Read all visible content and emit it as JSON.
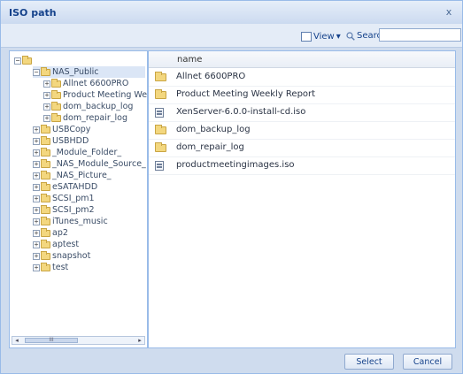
{
  "dialog": {
    "title": "ISO path",
    "close_glyph": "x"
  },
  "toolbar": {
    "view_label": "View",
    "view_arrow": "▾",
    "search_label": "Search",
    "search_value": ""
  },
  "tree": {
    "root": "",
    "items": [
      {
        "label": "NAS_Public",
        "exp": "⊟",
        "depth": 1,
        "selected": true
      },
      {
        "label": "Allnet 6600PRO",
        "exp": "⊞",
        "depth": 2
      },
      {
        "label": "Product Meeting We",
        "exp": "⊞",
        "depth": 2
      },
      {
        "label": "dom_backup_log",
        "exp": "⊞",
        "depth": 2
      },
      {
        "label": "dom_repair_log",
        "exp": "⊞",
        "depth": 2
      },
      {
        "label": "USBCopy",
        "exp": "⊞",
        "depth": 1
      },
      {
        "label": "USBHDD",
        "exp": "⊞",
        "depth": 1
      },
      {
        "label": "_Module_Folder_",
        "exp": "⊞",
        "depth": 1
      },
      {
        "label": "_NAS_Module_Source_",
        "exp": "⊞",
        "depth": 1
      },
      {
        "label": "_NAS_Picture_",
        "exp": "⊞",
        "depth": 1
      },
      {
        "label": "eSATAHDD",
        "exp": "⊞",
        "depth": 1
      },
      {
        "label": "SCSI_pm1",
        "exp": "⊞",
        "depth": 1
      },
      {
        "label": "SCSI_pm2",
        "exp": "⊞",
        "depth": 1
      },
      {
        "label": "iTunes_music",
        "exp": "⊞",
        "depth": 1
      },
      {
        "label": "ap2",
        "exp": "⊞",
        "depth": 1
      },
      {
        "label": "aptest",
        "exp": "⊞",
        "depth": 1
      },
      {
        "label": "snapshot",
        "exp": "⊞",
        "depth": 1
      },
      {
        "label": "test",
        "exp": "⊞",
        "depth": 1
      }
    ]
  },
  "list": {
    "header": "name",
    "rows": [
      {
        "name": "Allnet 6600PRO",
        "type": "folder"
      },
      {
        "name": "Product Meeting Weekly Report",
        "type": "folder"
      },
      {
        "name": "XenServer-6.0.0-install-cd.iso",
        "type": "file"
      },
      {
        "name": "dom_backup_log",
        "type": "folder"
      },
      {
        "name": "dom_repair_log",
        "type": "folder"
      },
      {
        "name": "productmeetingimages.iso",
        "type": "file"
      }
    ]
  },
  "scroll": {
    "left_glyph": "◂",
    "right_glyph": "▸",
    "thumb_glyph": "III"
  },
  "footer": {
    "select_label": "Select",
    "cancel_label": "Cancel"
  }
}
